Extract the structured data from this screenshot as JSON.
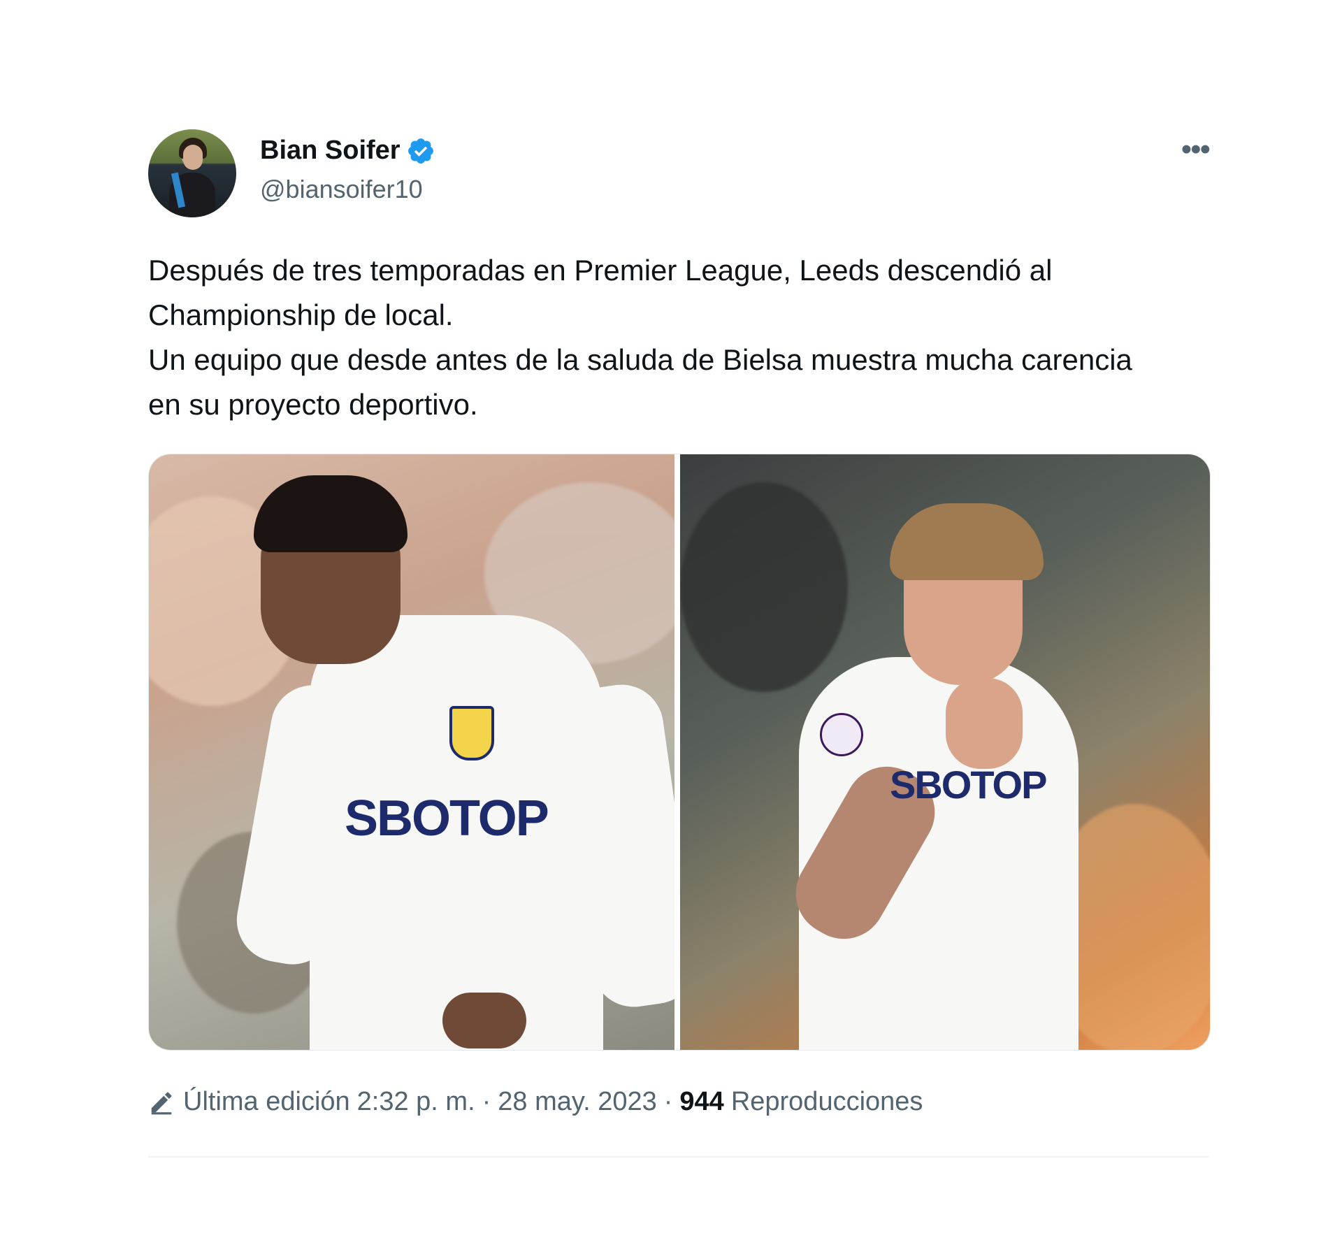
{
  "author": {
    "name": "Bian Soifer",
    "handle": "@biansoifer10",
    "verified_color": "#1d9bf0"
  },
  "tweet": {
    "text": "Después de tres temporadas en Premier League, Leeds descendió al\nChampionship de local.\nUn equipo que desde antes de la saluda de Bielsa muestra mucha carencia\nen su proyecto deportivo.",
    "more_icon": "more-icon"
  },
  "media": {
    "left_sponsor": "SBOTOP",
    "right_sponsor": "SBOTOP"
  },
  "footer": {
    "edited_label": "Última edición",
    "time": "2:32 p. m.",
    "date": "28 may. 2023",
    "views_count": "944",
    "views_label": "Reproducciones",
    "separator": "·"
  },
  "colors": {
    "text_primary": "#0f1419",
    "text_secondary": "#536471",
    "accent": "#1d9bf0"
  }
}
